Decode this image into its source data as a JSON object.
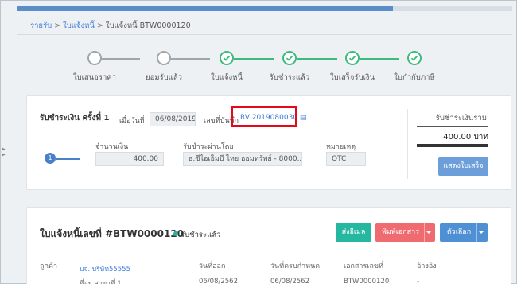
{
  "breadcrumb": {
    "items": [
      "รายรับ",
      "ใบแจ้งหนี้",
      "ใบแจ้งหนี้ BTW0000120"
    ],
    "separator": ">"
  },
  "stepper": {
    "steps": [
      {
        "label": "ใบเสนอราคา",
        "state": "pending"
      },
      {
        "label": "ยอมรับแล้ว",
        "state": "pending"
      },
      {
        "label": "ใบแจ้งหนี้",
        "state": "done"
      },
      {
        "label": "รับชำระแล้ว",
        "state": "done"
      },
      {
        "label": "ใบเสร็จรับเงิน",
        "state": "done"
      },
      {
        "label": "ใบกำกับภาษี",
        "state": "done"
      }
    ],
    "colors": {
      "done": "#3dbb7d",
      "pending": "#9ea6ae"
    }
  },
  "payment": {
    "title": "รับชำระเงิน ครั้งที่ 1",
    "date_label": "เมื่อวันที่",
    "date_value": "06/08/2019",
    "ref_label": "เลขที่บันทึก",
    "ref_value": "RV 2019080030",
    "step_number": "1",
    "amount_label": "จำนวนเงิน",
    "amount_value": "400.00",
    "channel_label": "รับชำระผ่านโดย",
    "channel_value": "ธ.ซีไอเอ็มบี ไทย ออมทรัพย์ - 8000...",
    "note_label": "หมายเหตุ",
    "note_value": "OTC",
    "total_label": "รับชำระเงินรวม",
    "total_value": "400.00",
    "currency": "บาท",
    "show_receipt_button": "แสดงใบเสร็จ"
  },
  "invoice": {
    "title": "ใบแจ้งหนี้เลขที่ #BTW0000120",
    "status": "รับชำระแล้ว",
    "status_color": "#27b2a3",
    "send_mail_button": "ส่งอีเมล",
    "print_button": "พิมพ์เอกสาร",
    "options_button": "ตัวเลือก",
    "columns": {
      "customer": "ลูกค้า",
      "issue_date": "วันที่ออก",
      "due_date": "วันที่ครบกำหนด",
      "doc_no": "เอกสารเลขที่",
      "reference": "อ้างอิง"
    },
    "row": {
      "customer": "บจ. บริษัท55555",
      "issue_date": "06/08/2562",
      "due_date": "06/08/2562",
      "doc_no": "BTW0000120",
      "reference": "-",
      "branch": "ที่อยู่ สาขาที่ 1"
    }
  }
}
